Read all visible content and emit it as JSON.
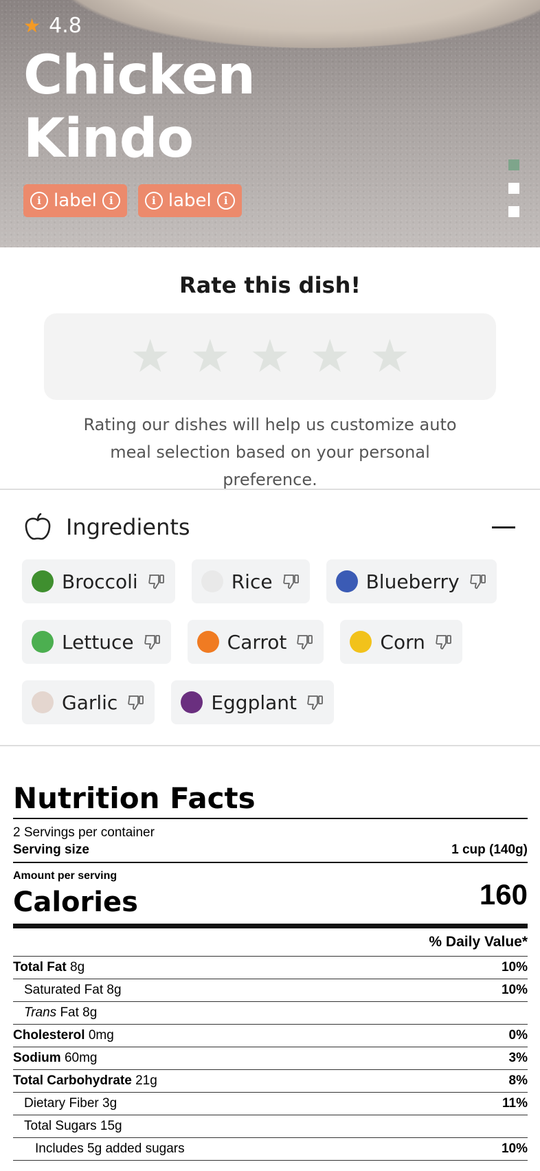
{
  "hero": {
    "rating": "4.8",
    "title": "Chicken Kindo",
    "tags": [
      "label",
      "label"
    ]
  },
  "rate": {
    "title": "Rate this dish!",
    "description": "Rating our dishes will help us customize auto meal selection based on your personal preference."
  },
  "ingredients": {
    "title": "Ingredients",
    "items": [
      {
        "name": "Broccoli",
        "icon": "broccoli-icon",
        "color": "#3f8f2f"
      },
      {
        "name": "Rice",
        "icon": "rice-bowl-icon",
        "color": "#e9e9e9"
      },
      {
        "name": "Blueberry",
        "icon": "blueberry-icon",
        "color": "#3b5bb5"
      },
      {
        "name": "Lettuce",
        "icon": "lettuce-icon",
        "color": "#4caf50"
      },
      {
        "name": "Carrot",
        "icon": "carrot-icon",
        "color": "#f07b22"
      },
      {
        "name": "Corn",
        "icon": "corn-icon",
        "color": "#f2c21b"
      },
      {
        "name": "Garlic",
        "icon": "garlic-icon",
        "color": "#e4d6cf"
      },
      {
        "name": "Eggplant",
        "icon": "eggplant-icon",
        "color": "#6a2f7f"
      }
    ]
  },
  "nutrition": {
    "title": "Nutrition Facts",
    "servings": "2 Servings per container",
    "serving_size_label": "Serving size",
    "serving_size_value": "1 cup (140g)",
    "amount_label": "Amount per serving",
    "calories_label": "Calories",
    "calories_value": "160",
    "daily_value_label": "% Daily Value*",
    "rows": [
      {
        "bold": "Total Fat",
        "amount": "8g",
        "pct": "10%",
        "indent": 0
      },
      {
        "bold": "",
        "amount": "Saturated Fat 8g",
        "pct": "10%",
        "indent": 1
      },
      {
        "bold": "",
        "italic": "Trans",
        "amount": "Fat 8g",
        "pct": "",
        "indent": 1
      },
      {
        "bold": "Cholesterol",
        "amount": "0mg",
        "pct": "0%",
        "indent": 0
      },
      {
        "bold": "Sodium",
        "amount": "60mg",
        "pct": "3%",
        "indent": 0
      },
      {
        "bold": "Total Carbohydrate",
        "amount": "21g",
        "pct": "8%",
        "indent": 0
      },
      {
        "bold": "",
        "amount": "Dietary Fiber 3g",
        "pct": "11%",
        "indent": 1
      },
      {
        "bold": "",
        "amount": "Total Sugars 15g",
        "pct": "",
        "indent": 1
      },
      {
        "bold": "",
        "amount": "Includes 5g added sugars",
        "pct": "10%",
        "indent": 2
      }
    ]
  },
  "colors": {
    "accent_tag": "#ec8a6c",
    "star_rating": "#f59a23",
    "carousel_active": "#7ea58b"
  }
}
